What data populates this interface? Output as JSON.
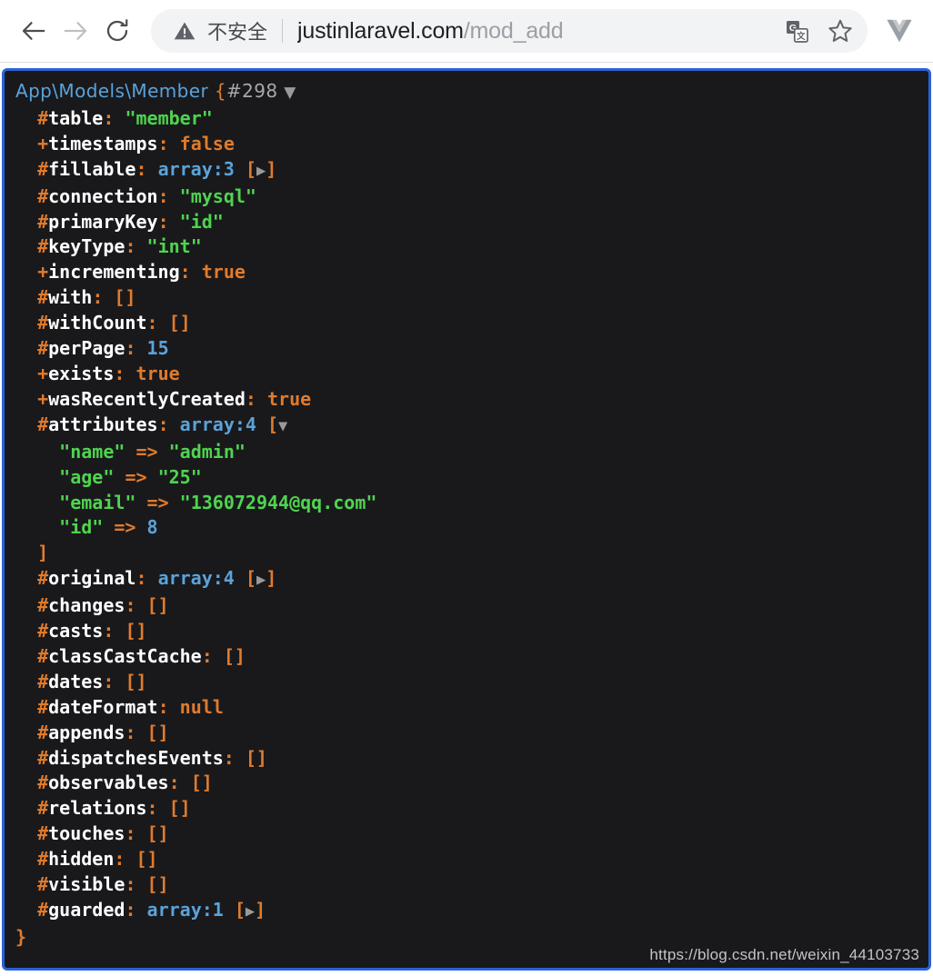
{
  "browser": {
    "back_label": "Back",
    "forward_label": "Forward",
    "reload_label": "Reload",
    "security_status": "不安全",
    "url_domain": "justinlaravel.com",
    "url_path": "/mod_add",
    "translate_label": "Translate this page",
    "bookmark_label": "Bookmark this tab",
    "extension_label": "Vue.js devtools"
  },
  "dump": {
    "class_name": "App\\Models\\Member",
    "open_brace": "{",
    "object_id": "#298",
    "expand_glyph": "▼",
    "collapse_glyph": "▶",
    "close_brace": "}",
    "close_bracket": "]",
    "lines": [
      {
        "indent": 1,
        "sigil": "#",
        "prop": "table",
        "kind": "string",
        "value": "member"
      },
      {
        "indent": 1,
        "sigil": "+",
        "prop": "timestamps",
        "kind": "bool",
        "value": "false"
      },
      {
        "indent": 1,
        "sigil": "#",
        "prop": "fillable",
        "kind": "array",
        "value": "array:3",
        "collapsed": true
      },
      {
        "indent": 1,
        "sigil": "#",
        "prop": "connection",
        "kind": "string",
        "value": "mysql"
      },
      {
        "indent": 1,
        "sigil": "#",
        "prop": "primaryKey",
        "kind": "string",
        "value": "id"
      },
      {
        "indent": 1,
        "sigil": "#",
        "prop": "keyType",
        "kind": "string",
        "value": "int"
      },
      {
        "indent": 1,
        "sigil": "+",
        "prop": "incrementing",
        "kind": "bool",
        "value": "true"
      },
      {
        "indent": 1,
        "sigil": "#",
        "prop": "with",
        "kind": "empty",
        "value": "[]"
      },
      {
        "indent": 1,
        "sigil": "#",
        "prop": "withCount",
        "kind": "empty",
        "value": "[]"
      },
      {
        "indent": 1,
        "sigil": "#",
        "prop": "perPage",
        "kind": "num",
        "value": "15"
      },
      {
        "indent": 1,
        "sigil": "+",
        "prop": "exists",
        "kind": "bool",
        "value": "true"
      },
      {
        "indent": 1,
        "sigil": "+",
        "prop": "wasRecentlyCreated",
        "kind": "bool",
        "value": "true"
      },
      {
        "indent": 1,
        "sigil": "#",
        "prop": "attributes",
        "kind": "array",
        "value": "array:4",
        "collapsed": false
      },
      {
        "indent": 2,
        "kind": "pair",
        "key": "name",
        "value": "admin",
        "value_kind": "string"
      },
      {
        "indent": 2,
        "kind": "pair",
        "key": "age",
        "value": "25",
        "value_kind": "string"
      },
      {
        "indent": 2,
        "kind": "pair",
        "key": "email",
        "value": "136072944@qq.com",
        "value_kind": "string"
      },
      {
        "indent": 2,
        "kind": "pair",
        "key": "id",
        "value": "8",
        "value_kind": "num"
      },
      {
        "indent": 1,
        "kind": "close_bracket"
      },
      {
        "indent": 1,
        "sigil": "#",
        "prop": "original",
        "kind": "array",
        "value": "array:4",
        "collapsed": true
      },
      {
        "indent": 1,
        "sigil": "#",
        "prop": "changes",
        "kind": "empty",
        "value": "[]"
      },
      {
        "indent": 1,
        "sigil": "#",
        "prop": "casts",
        "kind": "empty",
        "value": "[]"
      },
      {
        "indent": 1,
        "sigil": "#",
        "prop": "classCastCache",
        "kind": "empty",
        "value": "[]"
      },
      {
        "indent": 1,
        "sigil": "#",
        "prop": "dates",
        "kind": "empty",
        "value": "[]"
      },
      {
        "indent": 1,
        "sigil": "#",
        "prop": "dateFormat",
        "kind": "null",
        "value": "null"
      },
      {
        "indent": 1,
        "sigil": "#",
        "prop": "appends",
        "kind": "empty",
        "value": "[]"
      },
      {
        "indent": 1,
        "sigil": "#",
        "prop": "dispatchesEvents",
        "kind": "empty",
        "value": "[]"
      },
      {
        "indent": 1,
        "sigil": "#",
        "prop": "observables",
        "kind": "empty",
        "value": "[]"
      },
      {
        "indent": 1,
        "sigil": "#",
        "prop": "relations",
        "kind": "empty",
        "value": "[]"
      },
      {
        "indent": 1,
        "sigil": "#",
        "prop": "touches",
        "kind": "empty",
        "value": "[]"
      },
      {
        "indent": 1,
        "sigil": "#",
        "prop": "hidden",
        "kind": "empty",
        "value": "[]"
      },
      {
        "indent": 1,
        "sigil": "#",
        "prop": "visible",
        "kind": "empty",
        "value": "[]"
      },
      {
        "indent": 1,
        "sigil": "#",
        "prop": "guarded",
        "kind": "array",
        "value": "array:1",
        "collapsed": true
      }
    ]
  },
  "watermark": "https://blog.csdn.net/weixin_44103733",
  "colors": {
    "frame_border": "#2b62d9",
    "dump_background": "#19191c",
    "class": "#5ba3d9",
    "sigil": "#e07b2c",
    "string": "#4fd44f",
    "number": "#5ba3d9",
    "bool": "#e07b2c",
    "omnibox_background": "#f1f3f4"
  }
}
